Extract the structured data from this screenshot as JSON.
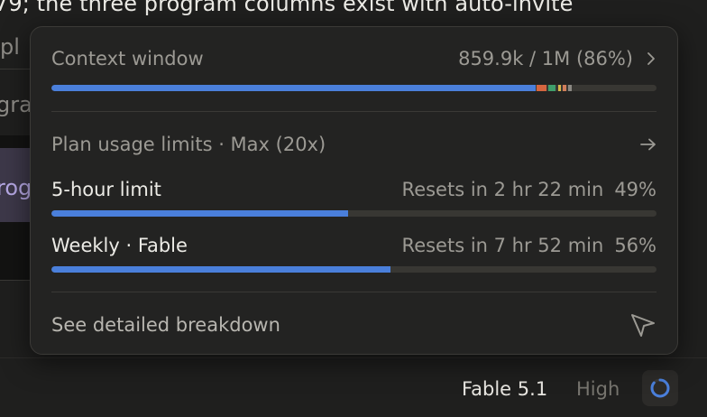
{
  "background": {
    "top_line": "79; the three program columns exist with auto-invite",
    "frag_1": "pl",
    "frag_2": "gra",
    "frag_3": "rog"
  },
  "popover": {
    "context": {
      "label": "Context window",
      "value": "859.9k / 1M (86%)",
      "fraction": 0.86,
      "segments": [
        {
          "color": "#d4653f"
        },
        {
          "color": "#3f9e6b"
        },
        {
          "color": "#d6b64a"
        },
        {
          "color": "#d07d5a"
        },
        {
          "color": "#8a8883"
        }
      ]
    },
    "plan": {
      "label": "Plan usage limits · Max (20x)"
    },
    "limits": [
      {
        "label": "5-hour limit",
        "reset": "Resets in 2 hr 22 min",
        "percent": "49%",
        "fraction": 0.49
      },
      {
        "label": "Weekly · Fable",
        "reset": "Resets in 7 hr 52 min",
        "percent": "56%",
        "fraction": 0.56
      }
    ],
    "footer": {
      "label": "See detailed breakdown"
    }
  },
  "bottom_bar": {
    "model": "Fable 5.1",
    "effort": "High"
  },
  "icons": {
    "chevron": "chevron-right-icon",
    "arrow": "arrow-right-icon",
    "cursor": "cursor-pointer-icon",
    "ring": "progress-ring-icon"
  },
  "colors": {
    "accent": "#4a7fdb",
    "track": "#383733"
  }
}
